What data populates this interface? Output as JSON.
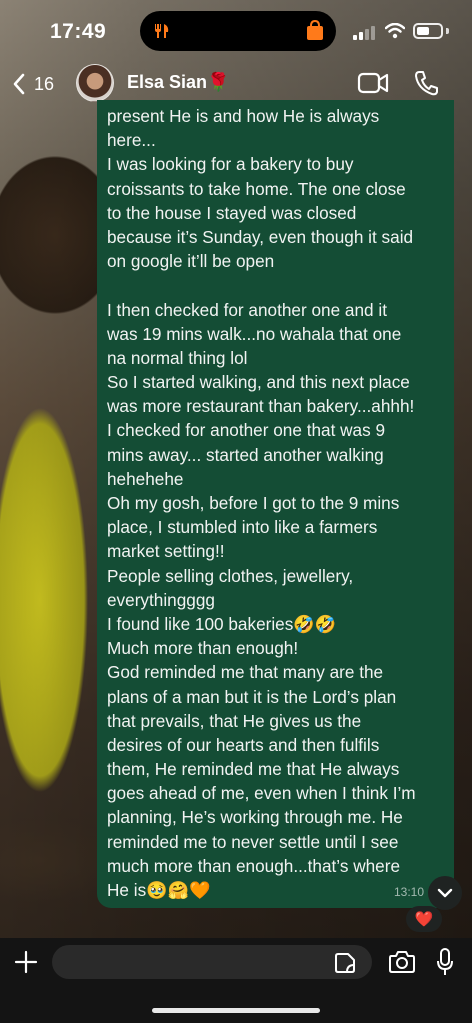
{
  "status_bar": {
    "time": "17:49"
  },
  "header": {
    "back_count": "16",
    "contact_name": "Elsa Sian🌹"
  },
  "message": {
    "lines": [
      "present He is and how He is always",
      "here...",
      "I was looking for a bakery to buy",
      "croissants to take home. The one close",
      "to the house I stayed was closed",
      "because it’s Sunday, even though it said",
      "on google it’ll be open",
      "",
      "I then checked for another one and it",
      "was 19 mins walk...no wahala that one",
      "na normal thing lol",
      "So I started walking, and this next place",
      "was more restaurant than bakery...ahhh!",
      "I checked for another one that was 9",
      "mins away... started another walking",
      "hehehehe",
      "Oh my gosh, before I got to the 9 mins",
      "place, I stumbled into like a farmers",
      "market setting!!",
      "People selling clothes, jewellery,",
      "everythingggg",
      "I found like 100 bakeries🤣🤣",
      "Much more than enough!",
      "God reminded me that many are the",
      "plans of a man but it is the Lord’s plan",
      "that prevails, that He gives us the",
      "desires of our hearts and then fulfils",
      "them, He reminded me that He always",
      "goes ahead of me, even when I think I’m",
      "planning, He’s working through me. He",
      "reminded me to never settle until I see",
      "much more than enough...that’s where",
      "He is🥹🤗🧡"
    ],
    "time": "13:10",
    "reaction": "❤️"
  },
  "composer": {
    "input_value": ""
  },
  "colors": {
    "bubble": "#144d35",
    "accent_orange": "#ff7a1a"
  }
}
